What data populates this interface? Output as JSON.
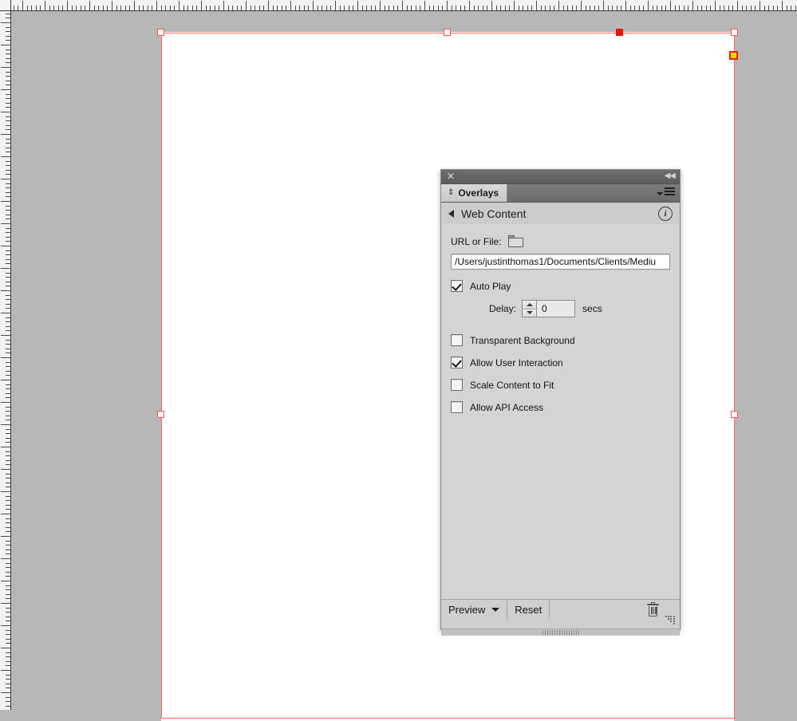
{
  "window": {
    "canvas_bg": "#b7b7b7",
    "page_bg": "#ffffff",
    "selection_color": "#ff6a5e"
  },
  "rulers": {
    "horizontal_name": "horizontal-ruler",
    "vertical_name": "vertical-ruler"
  },
  "selection": {
    "handles": [
      {
        "name": "handle-top-left",
        "type": "corner"
      },
      {
        "name": "handle-top-center",
        "type": "edge"
      },
      {
        "name": "handle-top-filled",
        "type": "filled"
      },
      {
        "name": "handle-top-right",
        "type": "corner"
      },
      {
        "name": "handle-content-grabber",
        "type": "content"
      },
      {
        "name": "handle-middle-left",
        "type": "edge"
      },
      {
        "name": "handle-middle-right",
        "type": "edge"
      }
    ]
  },
  "panel": {
    "close_glyph": "✕",
    "collapse_glyph": "◀◀",
    "tab": {
      "label": "Overlays",
      "chevron_glyph": "⇕"
    },
    "flyout_menu_name": "panel-flyout-menu",
    "header": {
      "title": "Web Content",
      "back_arrow_name": "back-arrow-icon",
      "info_label": "i"
    },
    "form": {
      "url_label": "URL or File:",
      "browse_icon": "folder-icon",
      "url_value": "/Users/justinthomas1/Documents/Clients/Mediu",
      "url_placeholder": "URL or File",
      "auto_play": {
        "label": "Auto Play",
        "checked": true
      },
      "delay": {
        "label": "Delay:",
        "value": "0",
        "units": "secs"
      },
      "checkboxes": [
        {
          "label": "Transparent Background",
          "checked": false
        },
        {
          "label": "Allow User Interaction",
          "checked": true
        },
        {
          "label": "Scale Content to Fit",
          "checked": false
        },
        {
          "label": "Allow API Access",
          "checked": false
        }
      ]
    },
    "footer": {
      "preview_label": "Preview",
      "reset_label": "Reset",
      "delete_icon": "trash-icon",
      "resize_grip": "resize-grip-icon"
    }
  }
}
